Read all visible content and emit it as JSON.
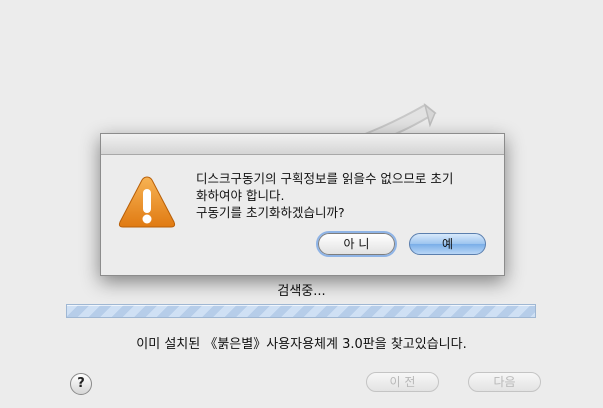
{
  "dialog": {
    "message_lines": [
      "디스크구동기의 구획정보를 읽을수 없으므로 초기",
      "화하여야 합니다.",
      "구동기를 초기화하겠습니까?"
    ],
    "no_label": "아 니",
    "yes_label": "예",
    "icon": "warning-triangle-icon"
  },
  "installer": {
    "searching_label": "검색중...",
    "status_message": "이미 설치된 《붉은별》사용자용체계 3.0판을 찾고있습니다.",
    "help_label": "?",
    "back_label": "이 전",
    "next_label": "다음",
    "progress_state": "indeterminate"
  },
  "colors": {
    "warning_orange": "#e98a1d",
    "default_button_blue": "#8fbbee",
    "progress_stripe": "#c4d8f0"
  }
}
